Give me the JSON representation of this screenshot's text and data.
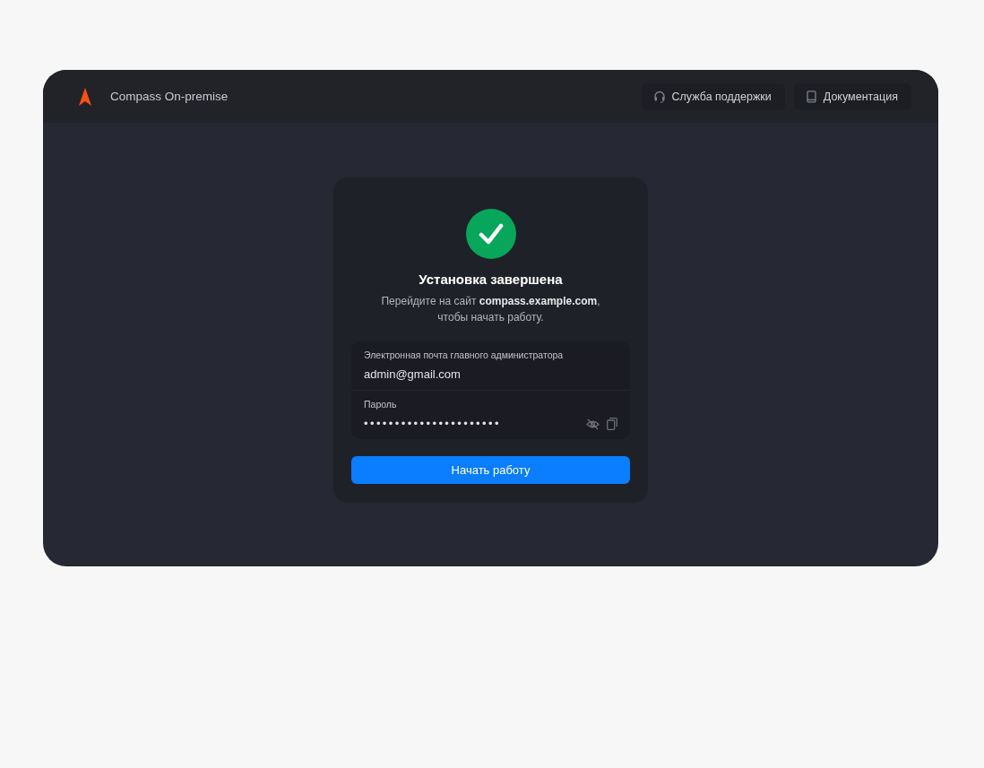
{
  "window": {
    "brand": "Compass On-premise",
    "header_buttons": [
      {
        "kind": "support",
        "label": "Служба поддержки"
      },
      {
        "kind": "docs",
        "label": "Документация"
      }
    ]
  },
  "card": {
    "completed": true,
    "title": "Установка завершена",
    "message": "Перейдите на сайт **compass.example.com**,\nчтобы начать работу.",
    "fields": [
      {
        "kind": "email",
        "label": "Электронная почта главного администратора",
        "value": "admin@gmail.com"
      },
      {
        "kind": "password",
        "label": "Пароль",
        "value": "••••••••••••••••••••••"
      }
    ],
    "button": {
      "label": "Начать работу"
    }
  }
}
